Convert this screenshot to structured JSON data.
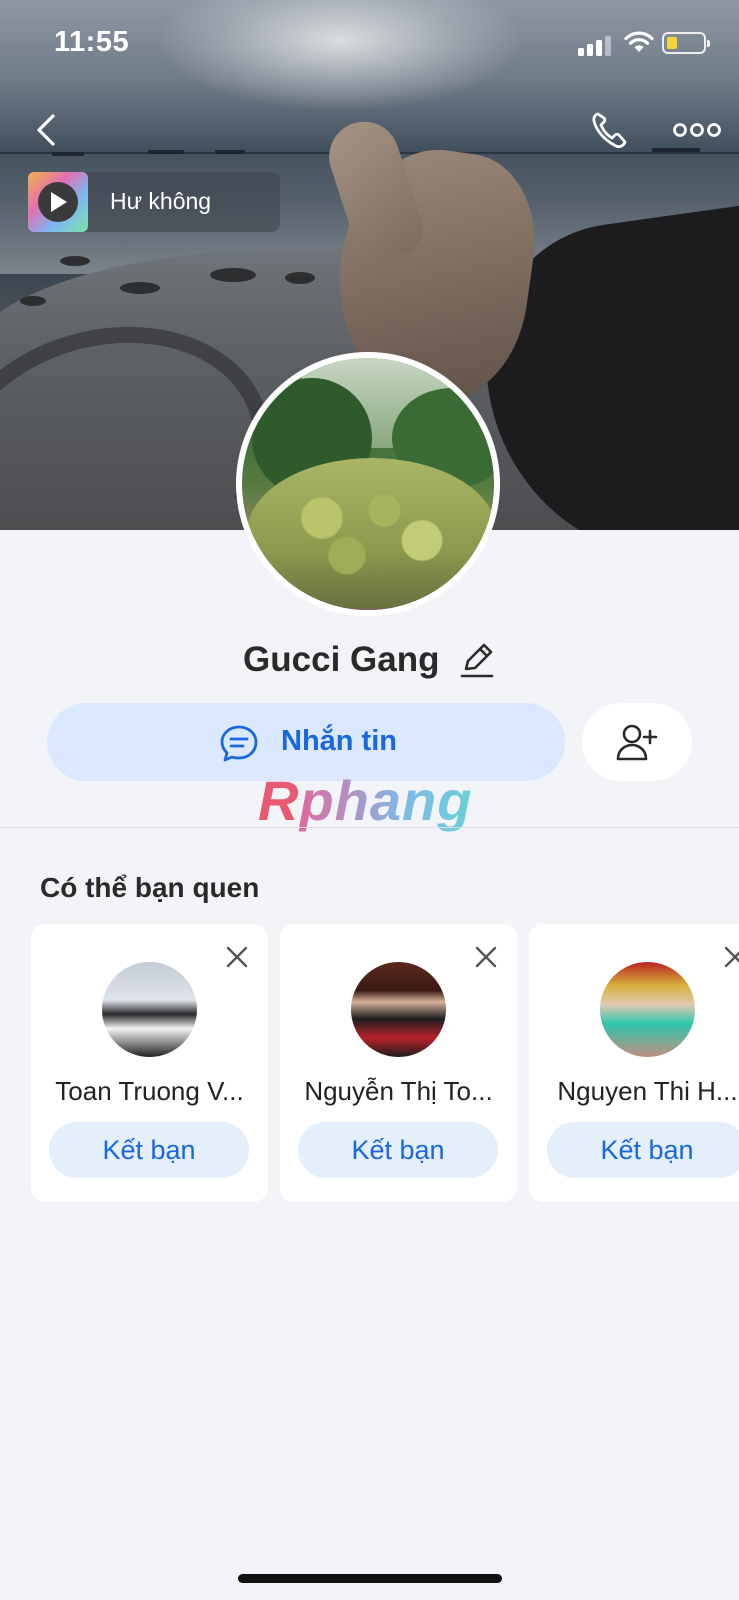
{
  "status_bar": {
    "time": "11:55",
    "battery_level": 0.3
  },
  "cover": {
    "music": {
      "title": "Hư không"
    }
  },
  "profile": {
    "name": "Gucci Gang",
    "message_label": "Nhắn tin"
  },
  "watermark": {
    "part1": "R",
    "part2": "phang"
  },
  "suggestions": {
    "title": "Có thể bạn quen",
    "cards": [
      {
        "name": "Toan Truong V...",
        "button": "Kết bạn"
      },
      {
        "name": "Nguyễn Thị To...",
        "button": "Kết bạn"
      },
      {
        "name": "Nguyen Thi H...",
        "button": "Kết bạn"
      }
    ]
  },
  "colors": {
    "accent": "#1968e0",
    "button_bg": "#dbe8fd",
    "page_bg": "#f2f4f7"
  },
  "icons": [
    "back-icon",
    "phone-icon",
    "more-icon",
    "play-icon",
    "edit-icon",
    "chat-icon",
    "add-friend-icon",
    "close-icon"
  ]
}
